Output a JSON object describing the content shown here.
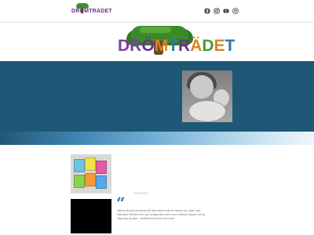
{
  "header": {
    "small_logo_text": "DRÖMTRÄDET",
    "social": [
      {
        "name": "facebook-icon",
        "color": "#444444"
      },
      {
        "name": "instagram-icon",
        "color": "#444444"
      },
      {
        "name": "youtube-icon",
        "color": "#444444"
      },
      {
        "name": "email-icon",
        "color": "#444444"
      }
    ]
  },
  "logo": {
    "letters": [
      "D",
      "R",
      "Ö",
      "M",
      "T",
      "R",
      "Ä",
      "D",
      "E",
      "T"
    ],
    "letter_colors": [
      "#7b3f98",
      "#7b3f98",
      "#6a2f8f",
      "#d9841f",
      "#2f77a3",
      "#6a2f8f",
      "#d9841f",
      "#4a9a36",
      "#d9841f",
      "#2f77a3"
    ]
  },
  "hero": {
    "background": "#1f5876",
    "photo_alt": "Porträtt av en kvinna och ett barn med en trumma"
  },
  "content": {
    "quote_mark": "“",
    "quote": "Idéerna till sina barnböcker får Nina Nilsson från sin fantasi och möten med människor. Böckerna tar upp vardagsnära ämnen som vänskap, känslor och att våga vara sig själv – berättat med värme och humor."
  },
  "colors": {
    "accent": "#2f77a3",
    "hero": "#1f5876",
    "stripe_end": "#eef7fc"
  }
}
